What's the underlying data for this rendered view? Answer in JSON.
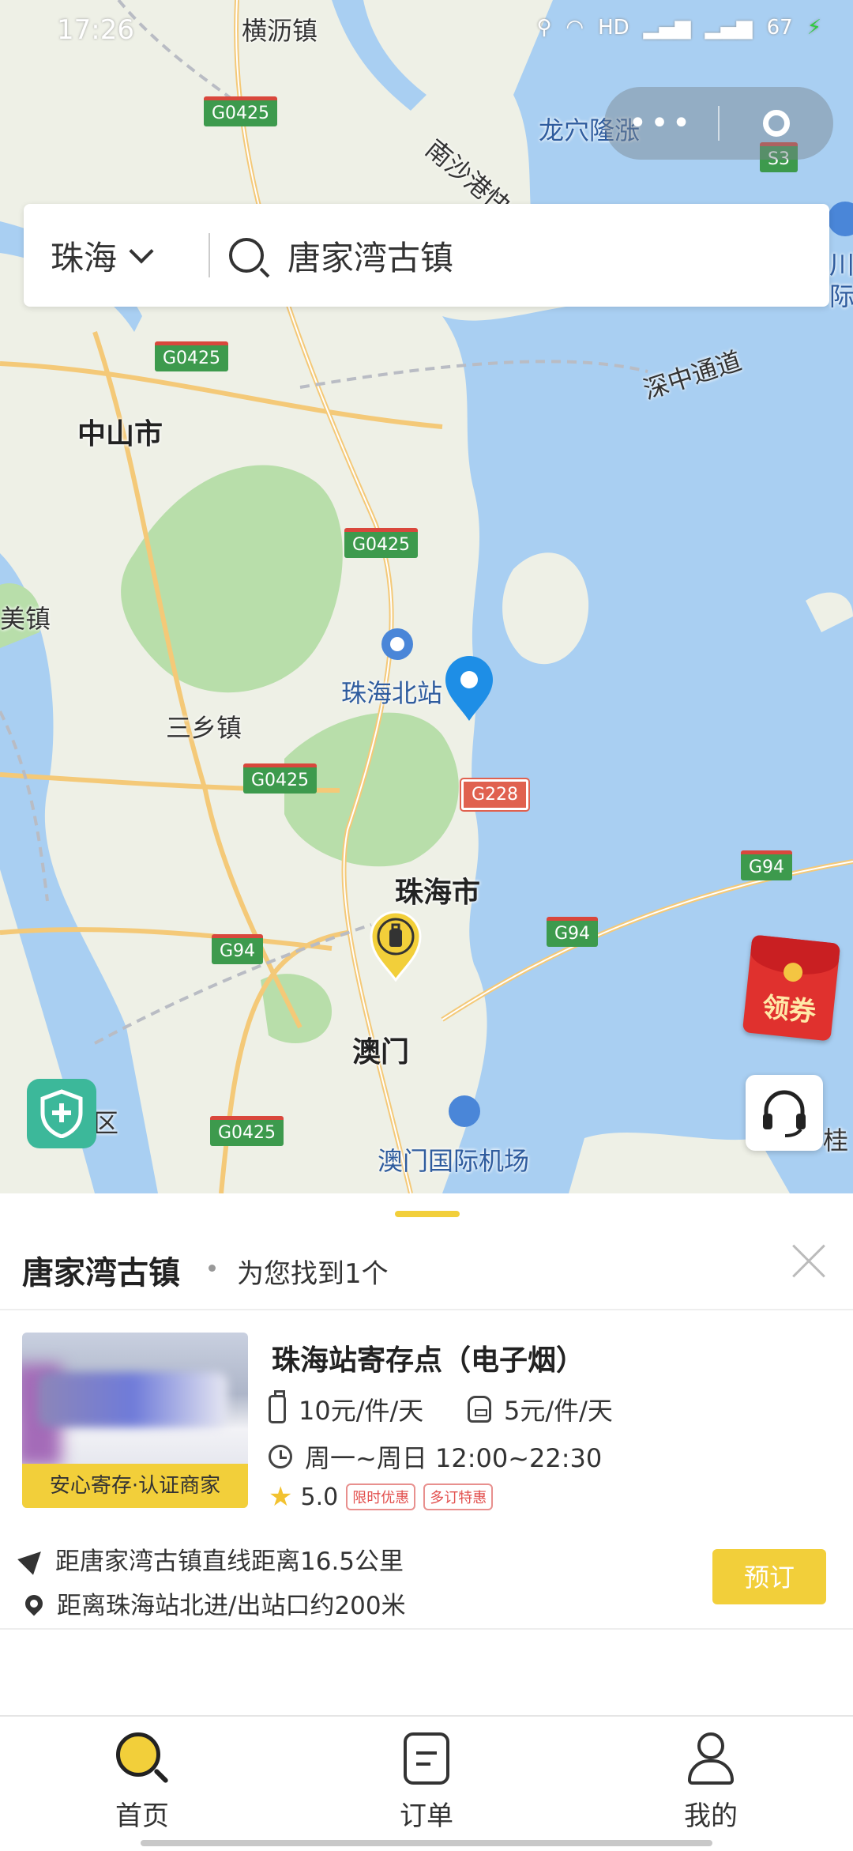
{
  "status_bar": {
    "time": "17:26",
    "battery": "67"
  },
  "capsule": {
    "more_label": "•••"
  },
  "search": {
    "city": "珠海",
    "query": "唐家湾古镇"
  },
  "map": {
    "labels": {
      "hengli": "横沥镇",
      "longxue": "龙穴隆涨",
      "nansha": "南沙港快",
      "shenzhong": "深中通道",
      "zhongshan": "中山市",
      "sanxiang": "三乡镇",
      "zhuhai_north": "珠海北站",
      "zhuhai_city": "珠海市",
      "macau": "澳门",
      "macau_airport": "澳门国际机场",
      "district": "区",
      "gui": "桂",
      "jiazhen": "美镇",
      "chuan": "川",
      "ji": "际"
    },
    "shields": {
      "g0425": "G0425",
      "g94": "G94",
      "g228": "G228",
      "s3": "S3"
    }
  },
  "coupon": {
    "label": "领券"
  },
  "results": {
    "title": "唐家湾古镇",
    "count_text": "为您找到1个"
  },
  "store": {
    "name": "珠海站寄存点（电子烟）",
    "badge": "安心寄存·认证商家",
    "price_luggage": "10元/件/天",
    "price_bag": "5元/件/天",
    "hours": "周一~周日 12:00~22:30",
    "rating": "5.0",
    "tags": [
      "限时优惠",
      "多订特惠"
    ],
    "distance": "距唐家湾古镇直线距离16.5公里",
    "walk": "距离珠海站北进/出站口约200米",
    "book_label": "预订"
  },
  "tabs": {
    "home": "首页",
    "orders": "订单",
    "mine": "我的"
  },
  "colors": {
    "accent": "#f2cf3a",
    "water": "#a9cff2",
    "park": "#b8deaa",
    "pin_blue": "#1e8ee6"
  }
}
